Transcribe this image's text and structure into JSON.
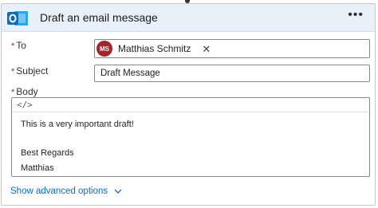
{
  "header": {
    "title": "Draft an email message",
    "more_label": "•••",
    "brand_color": "#0f6cbd",
    "app_icon": "outlook-icon"
  },
  "fields": {
    "to": {
      "label": "To",
      "recipient_initials": "MS",
      "recipient_name": "Matthias Schmitz",
      "remove_label": "✕",
      "avatar_color": "#a4262c"
    },
    "subject": {
      "label": "Subject",
      "value": "Draft Message"
    },
    "body": {
      "label": "Body",
      "code_view_icon": "</>",
      "lines": [
        "This is a very important draft!",
        "Best Regards",
        "Matthias"
      ]
    }
  },
  "required_marker": "*",
  "advanced_label": "Show advanced options"
}
